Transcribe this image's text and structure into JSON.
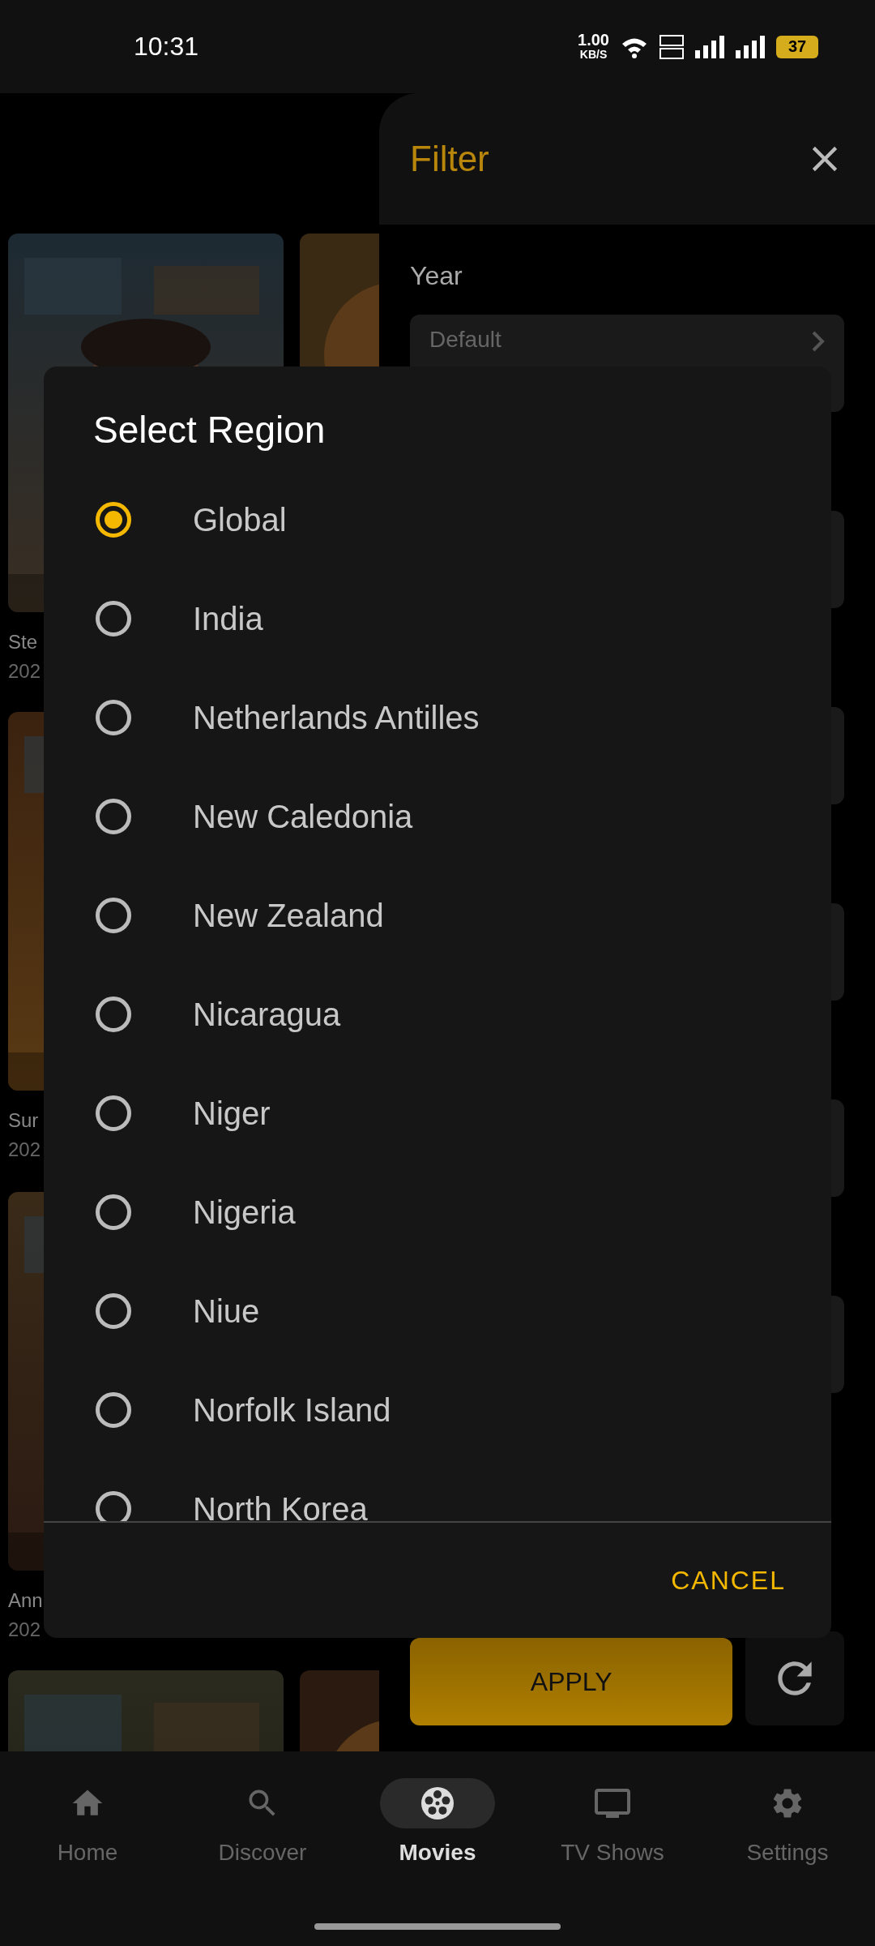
{
  "status_bar": {
    "time": "10:31",
    "net_speed": "1.00",
    "net_unit": "KB/S",
    "battery": "37"
  },
  "movies": [
    {
      "title": "Ste",
      "year": "202"
    },
    {
      "title": "Sur",
      "year": "202"
    },
    {
      "title": "Ann",
      "year": "202"
    }
  ],
  "filter": {
    "title": "Filter",
    "year_label": "Year",
    "year_value": "Default",
    "apply": "APPLY"
  },
  "dialog": {
    "title": "Select Region",
    "cancel": "CANCEL",
    "options": [
      {
        "label": "Global",
        "selected": true
      },
      {
        "label": "India",
        "selected": false
      },
      {
        "label": "Netherlands Antilles",
        "selected": false
      },
      {
        "label": "New Caledonia",
        "selected": false
      },
      {
        "label": "New Zealand",
        "selected": false
      },
      {
        "label": "Nicaragua",
        "selected": false
      },
      {
        "label": "Niger",
        "selected": false
      },
      {
        "label": "Nigeria",
        "selected": false
      },
      {
        "label": "Niue",
        "selected": false
      },
      {
        "label": "Norfolk Island",
        "selected": false
      },
      {
        "label": "North Korea",
        "selected": false
      }
    ]
  },
  "nav": [
    {
      "label": "Home",
      "kind": "home",
      "selected": false
    },
    {
      "label": "Discover",
      "kind": "search",
      "selected": false
    },
    {
      "label": "Movies",
      "kind": "reel",
      "selected": true
    },
    {
      "label": "TV Shows",
      "kind": "tv",
      "selected": false
    },
    {
      "label": "Settings",
      "kind": "settings",
      "selected": false
    }
  ]
}
